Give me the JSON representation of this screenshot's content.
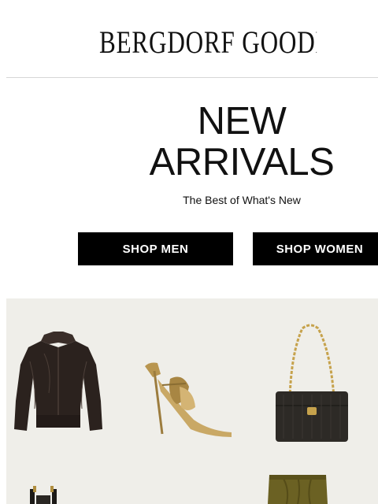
{
  "header": {
    "brand": "BERGDORF GOODMAN"
  },
  "hero": {
    "title_line1": "NEW",
    "title_line2": "ARRIVALS",
    "subtitle": "The Best of What's New"
  },
  "buttons": {
    "shop_men": "SHOP MEN",
    "shop_women": "SHOP WOMEN"
  },
  "products": [
    {
      "icon": "leather-jacket-image"
    },
    {
      "icon": "gold-sandal-image"
    },
    {
      "icon": "woven-shoulder-bag-image"
    },
    {
      "icon": "black-gold-item-image"
    },
    {
      "icon": "olive-skirt-image"
    }
  ],
  "colors": {
    "background": "#ffffff",
    "panel": "#efeee9",
    "button_bg": "#000000",
    "button_text": "#ffffff",
    "divider": "#d6d6d6"
  }
}
